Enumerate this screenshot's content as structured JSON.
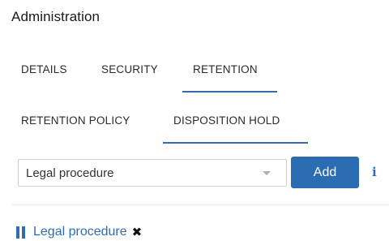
{
  "page": {
    "title": "Administration"
  },
  "tabs": [
    {
      "label": "DETAILS",
      "active": false
    },
    {
      "label": "SECURITY",
      "active": false
    },
    {
      "label": "RETENTION",
      "active": true
    }
  ],
  "subtabs": [
    {
      "label": "RETENTION POLICY",
      "active": false
    },
    {
      "label": "DISPOSITION HOLD",
      "active": true
    }
  ],
  "hold_form": {
    "selected_hold": "Legal procedure",
    "add_label": "Add",
    "info_glyph": "i"
  },
  "holds": [
    {
      "label": "Legal procedure",
      "icon": "pause-icon",
      "remove_glyph": "✖"
    }
  ],
  "colors": {
    "accent": "#2f6cb0",
    "button": "#2b6cb3"
  }
}
